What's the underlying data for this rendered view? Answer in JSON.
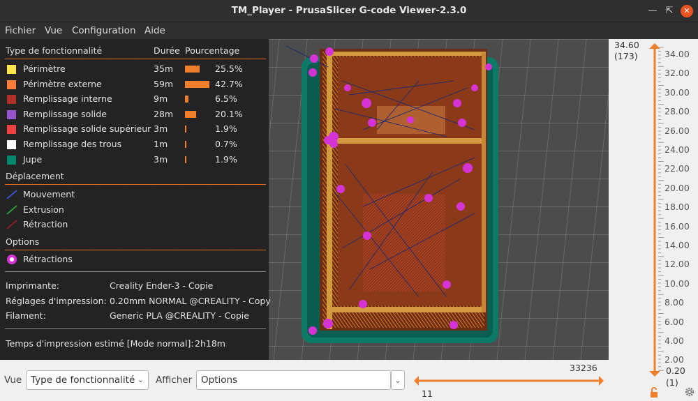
{
  "window": {
    "title": "TM_Player - PrusaSlicer G-code Viewer-2.3.0",
    "buttons": [
      "minimize",
      "maximize",
      "close"
    ]
  },
  "menu": {
    "items": [
      "Fichier",
      "Vue",
      "Configuration",
      "Aide"
    ]
  },
  "legend": {
    "headers": {
      "feature": "Type de fonctionnalité",
      "duration": "Durée",
      "percentage": "Pourcentage"
    },
    "features": [
      {
        "label": "Périmètre",
        "duration": "35m",
        "percent": "25.5%",
        "value": 25.5,
        "color": "#ffe64d"
      },
      {
        "label": "Périmètre externe",
        "duration": "59m",
        "percent": "42.7%",
        "value": 42.7,
        "color": "#ff7d38"
      },
      {
        "label": "Remplissage interne",
        "duration": "9m",
        "percent": "6.5%",
        "value": 6.5,
        "color": "#b03029"
      },
      {
        "label": "Remplissage solide",
        "duration": "28m",
        "percent": "20.1%",
        "value": 20.1,
        "color": "#9654cc"
      },
      {
        "label": "Remplissage solide supérieur",
        "duration": "3m",
        "percent": "1.9%",
        "value": 1.9,
        "color": "#f04040"
      },
      {
        "label": "Remplissage des trous",
        "duration": "1m",
        "percent": "0.7%",
        "value": 0.7,
        "color": "#ffffff"
      },
      {
        "label": "Jupe",
        "duration": "3m",
        "percent": "1.9%",
        "value": 1.9,
        "color": "#00876e"
      }
    ],
    "travel_title": "Déplacement",
    "travel": [
      {
        "label": "Mouvement",
        "color": "#3850c8"
      },
      {
        "label": "Extrusion",
        "color": "#2e9838"
      },
      {
        "label": "Rétraction",
        "color": "#8c2020"
      }
    ],
    "options_title": "Options",
    "options": [
      {
        "label": "Rétractions",
        "color": "#e040e0"
      }
    ],
    "info": [
      {
        "label": "Imprimante:",
        "value": "Creality Ender-3 - Copie"
      },
      {
        "label": "Réglages d'impression:",
        "value": "0.20mm NORMAL @CREALITY - Copy"
      },
      {
        "label": "Filament:",
        "value": "Generic PLA @CREALITY - Copie"
      }
    ],
    "time_label": "Temps d'impression estimé [Mode normal]:",
    "time_value": "2h18m"
  },
  "layer_slider": {
    "top_value": "34.60",
    "top_layer": "(173)",
    "bottom_value": "0.20",
    "bottom_layer": "(1)",
    "ticks": [
      "34.00",
      "32.00",
      "30.00",
      "28.00",
      "26.00",
      "24.00",
      "22.00",
      "20.00",
      "18.00",
      "16.00",
      "14.00",
      "12.00",
      "10.00",
      "8.00",
      "6.00",
      "4.00",
      "2.00"
    ],
    "lock_icon": "lock-icon",
    "settings_icon": "cog-icon",
    "accent": "#ef7f2a"
  },
  "bottom": {
    "view_label": "Vue",
    "view_value": "Type de fonctionnalité",
    "show_label": "Afficher",
    "show_value": "Options",
    "moves_max": "33236",
    "moves_min": "11"
  }
}
